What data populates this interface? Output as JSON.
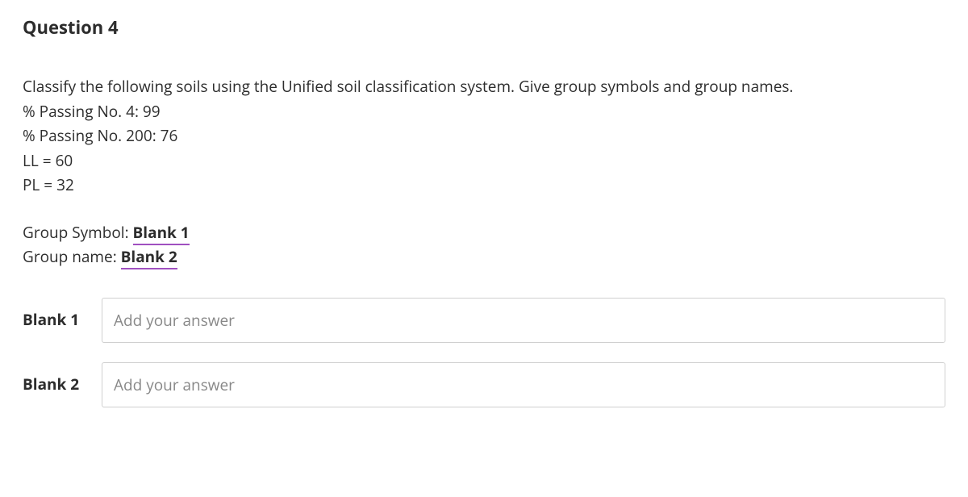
{
  "question": {
    "title": "Question 4",
    "instruction": "Classify the following soils using the Unified soil classification system. Give group symbols and group names.",
    "data": [
      "% Passing No. 4: 99",
      "% Passing No. 200: 76",
      "LL = 60",
      "PL = 32"
    ],
    "labels": {
      "groupSymbolPrefix": "Group Symbol: ",
      "groupSymbolBlank": "Blank 1",
      "groupNamePrefix": "Group name: ",
      "groupNameBlank": "Blank 2"
    }
  },
  "answers": {
    "blank1": {
      "label": "Blank 1",
      "placeholder": "Add your answer",
      "value": ""
    },
    "blank2": {
      "label": "Blank 2",
      "placeholder": "Add your answer",
      "value": ""
    }
  }
}
